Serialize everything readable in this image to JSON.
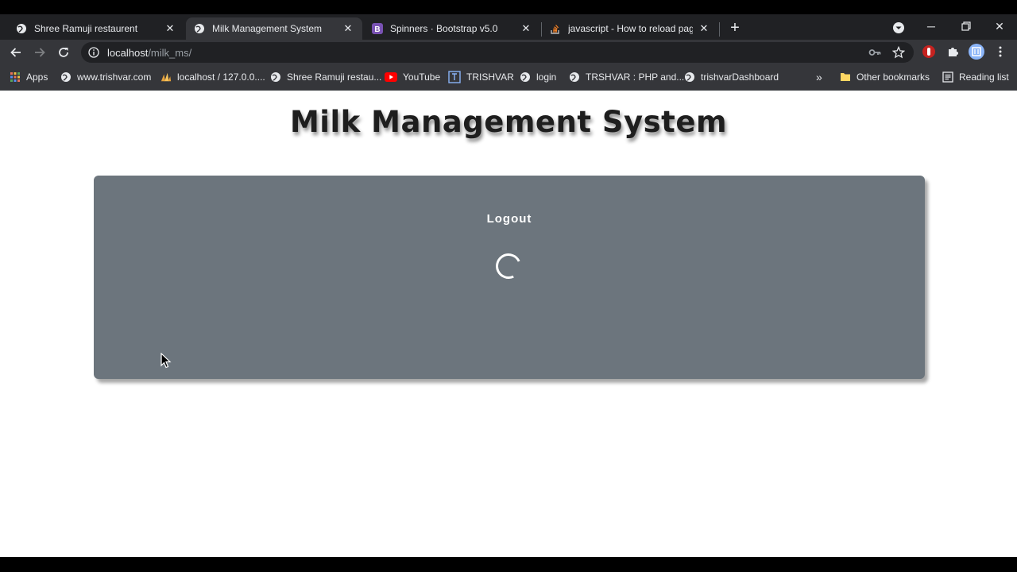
{
  "tabs": [
    {
      "title": "Shree Ramuji restaurent",
      "active": false,
      "icon": "globe-icon"
    },
    {
      "title": "Milk Management System",
      "active": true,
      "icon": "globe-icon"
    },
    {
      "title": "Spinners · Bootstrap v5.0",
      "active": false,
      "icon": "bootstrap-icon"
    },
    {
      "title": "javascript - How to reload page e",
      "active": false,
      "icon": "stackoverflow-icon"
    }
  ],
  "toolbar": {
    "url_host": "localhost",
    "url_path": "/milk_ms/"
  },
  "bookmarks": [
    {
      "label": "Apps",
      "icon": "apps-grid-icon"
    },
    {
      "label": "www.trishvar.com",
      "icon": "globe-icon"
    },
    {
      "label": "localhost / 127.0.0....",
      "icon": "phpmyadmin-icon"
    },
    {
      "label": "Shree Ramuji restau...",
      "icon": "globe-icon"
    },
    {
      "label": "YouTube",
      "icon": "youtube-icon"
    },
    {
      "label": "TRISHVAR",
      "icon": "trishvar-icon"
    },
    {
      "label": "login",
      "icon": "globe-icon"
    },
    {
      "label": "TRSHVAR : PHP and...",
      "icon": "globe-icon"
    },
    {
      "label": "trishvarDashboard",
      "icon": "globe-icon"
    }
  ],
  "bookmarks_overflow": "»",
  "other_bookmarks": "Other bookmarks",
  "reading_list": "Reading list",
  "page": {
    "heading": "Milk Management System",
    "card_text": "Logout"
  },
  "colors": {
    "card_bg": "#6c757d",
    "chrome_dark": "#202124",
    "chrome_toolbar": "#35363a"
  }
}
